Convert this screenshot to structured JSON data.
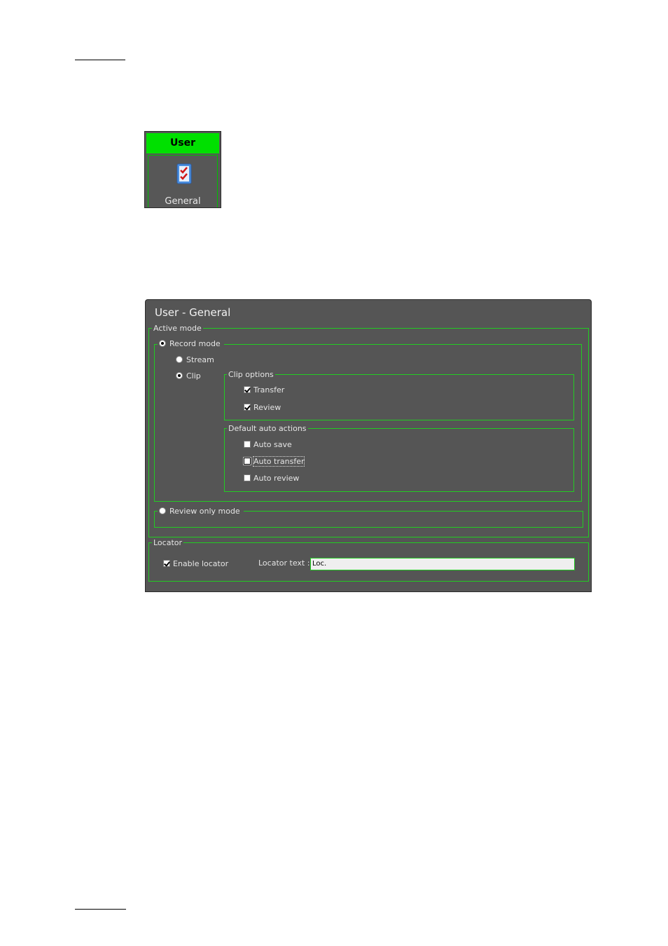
{
  "user_button": {
    "header": "User",
    "label": "General",
    "icon": "checklist-icon"
  },
  "dialog": {
    "title": "User - General",
    "active_mode": {
      "label": "Active mode",
      "record_mode": {
        "label": "Record mode",
        "selected": true,
        "stream_label": "Stream",
        "clip_label": "Clip",
        "clip_selected": true,
        "clip_options": {
          "label": "Clip options",
          "transfer_label": "Transfer",
          "transfer_checked": true,
          "review_label": "Review",
          "review_checked": true
        },
        "default_auto_actions": {
          "label": "Default auto actions",
          "auto_save_label": "Auto save",
          "auto_save_checked": false,
          "auto_transfer_label": "Auto transfer",
          "auto_transfer_checked": false,
          "auto_review_label": "Auto review",
          "auto_review_checked": false
        }
      },
      "review_only_mode": {
        "label": "Review only mode",
        "selected": false
      }
    },
    "locator": {
      "label": "Locator",
      "enable_label": "Enable locator",
      "enable_checked": true,
      "text_label": "Locator text :",
      "text_value": "Loc."
    }
  },
  "colors": {
    "accent_green": "#00e000",
    "panel_bg": "#555555",
    "frame_green": "#22cc22"
  }
}
